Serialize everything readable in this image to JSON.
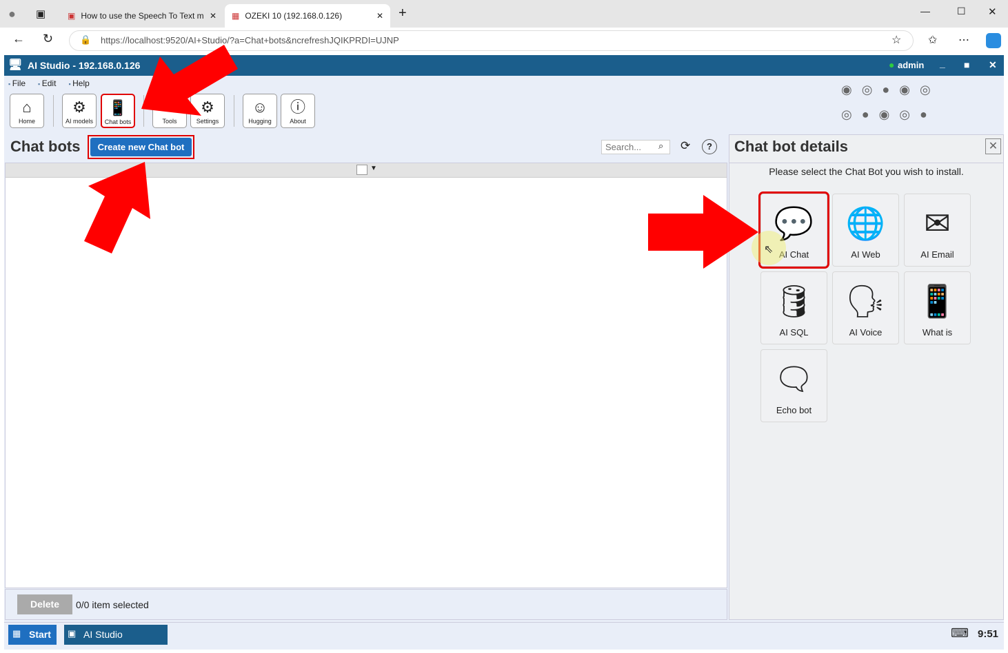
{
  "browser": {
    "tabs": [
      {
        "title": "How to use the Speech To Text m"
      },
      {
        "title": "OZEKI 10 (192.168.0.126)"
      }
    ],
    "url": "https://localhost:9520/AI+Studio/?a=Chat+bots&ncrefreshJQIKPRDI=UJNP"
  },
  "app": {
    "title": "AI Studio - 192.168.0.126",
    "user": "admin",
    "user_status_color": "#2ecc40"
  },
  "menu": [
    "File",
    "Edit",
    "Help"
  ],
  "toolbar": [
    {
      "label": "Home",
      "icon": "home-icon"
    },
    {
      "label": "AI models",
      "icon": "gear-network-icon"
    },
    {
      "label": "Chat bots",
      "icon": "chat-bots-icon"
    },
    {
      "label": "Tools",
      "icon": "tools-icon"
    },
    {
      "label": "Settings",
      "icon": "settings-icon"
    },
    {
      "label": "Hugging",
      "icon": "hugging-face-icon"
    },
    {
      "label": "About",
      "icon": "info-icon"
    }
  ],
  "left": {
    "title": "Chat bots",
    "create_label": "Create new Chat bot",
    "search_placeholder": "Search...",
    "delete_label": "Delete",
    "selection_status": "0/0 item selected"
  },
  "right": {
    "title": "Chat bot details",
    "instruction": "Please select the Chat Bot you wish to install.",
    "bots": [
      {
        "label": "AI Chat",
        "icon": "💬"
      },
      {
        "label": "AI Web",
        "icon": "🌐"
      },
      {
        "label": "AI Email",
        "icon": "✉"
      },
      {
        "label": "AI SQL",
        "icon": "🛢"
      },
      {
        "label": "AI Voice",
        "icon": "🗣"
      },
      {
        "label": "What is",
        "icon": "📱"
      },
      {
        "label": "Echo bot",
        "icon": "🗨"
      }
    ]
  },
  "taskbar": {
    "start_label": "Start",
    "app_label": "AI Studio",
    "time": "9:51"
  },
  "colors": {
    "highlight": "#e00000",
    "titlebar": "#1b5e8c",
    "create_button": "#1f6fc0"
  }
}
